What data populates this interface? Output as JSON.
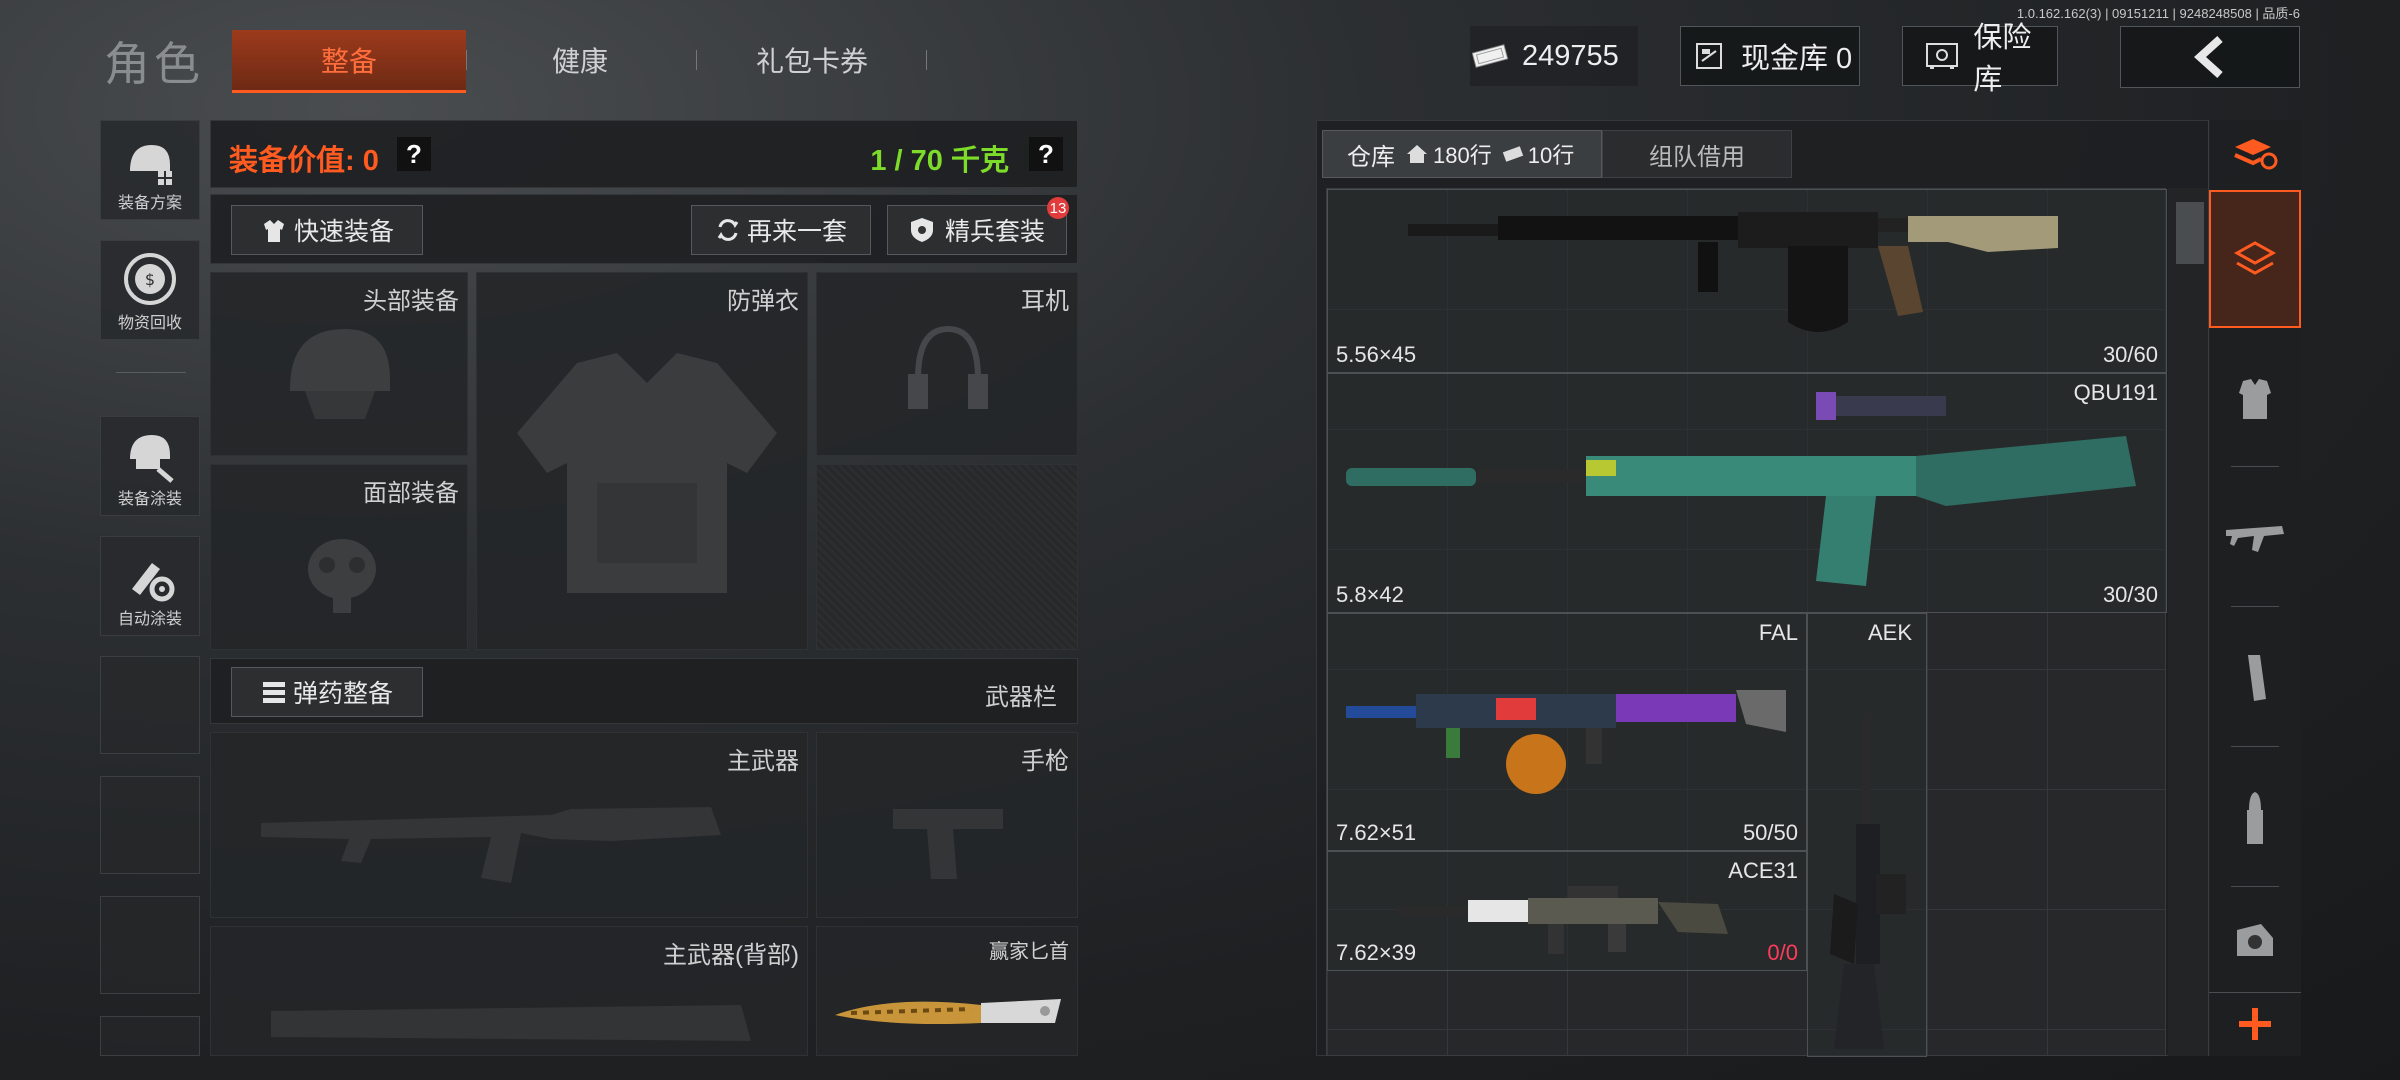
{
  "build_info": "1.0.162.162(3) | 09151211 | 9248248508 | 品质-6",
  "header": {
    "title": "角色",
    "tabs": [
      {
        "label": "整备",
        "active": true
      },
      {
        "label": "健康",
        "active": false
      },
      {
        "label": "礼包卡券",
        "active": false
      }
    ],
    "currency_amount": "249755",
    "cash_vault_label": "现金库 0",
    "safe_label": "保险库"
  },
  "sidebar": {
    "items": [
      {
        "label": "装备方案",
        "icon": "helmet-grid-icon"
      },
      {
        "label": "物资回收",
        "icon": "recycle-icon"
      },
      {
        "label": "装备涂装",
        "icon": "helmet-paint-icon"
      },
      {
        "label": "自动涂装",
        "icon": "brush-gear-icon"
      }
    ]
  },
  "loadout": {
    "value_label": "装备价值: 0",
    "weight_label": "1 / 70 千克",
    "help": "?",
    "quick_equip_label": "快速装备",
    "again_label": "再来一套",
    "elite_label": "精兵套装",
    "elite_badge": "13",
    "slots": {
      "head": "头部装备",
      "armor": "防弹衣",
      "headset": "耳机",
      "face": "面部装备",
      "primary": "主武器",
      "pistol": "手枪",
      "primary_back": "主武器(背部)",
      "knife": "赢家匕首"
    },
    "ammo_label": "弹药整备",
    "weapon_bar_label": "武器栏"
  },
  "warehouse": {
    "tab_label": "仓库",
    "rows_home": "180行",
    "rows_ticket": "10行",
    "team_borrow_label": "组队借用",
    "items": [
      {
        "name": "",
        "caliber": "5.56×45",
        "count": "30/60"
      },
      {
        "name": "QBU191",
        "caliber": "5.8×42",
        "count": "30/30"
      },
      {
        "name": "FAL",
        "caliber": "7.62×51",
        "count": "50/50"
      },
      {
        "name": "AEK",
        "caliber": "",
        "count": ""
      },
      {
        "name": "ACE31",
        "caliber": "7.62×39",
        "count_a": "0",
        "count_b": "/0"
      }
    ]
  },
  "colors": {
    "accent": "#ff5a1f",
    "weight_ok": "#7ddc2a",
    "danger": "#ff3b5c"
  }
}
